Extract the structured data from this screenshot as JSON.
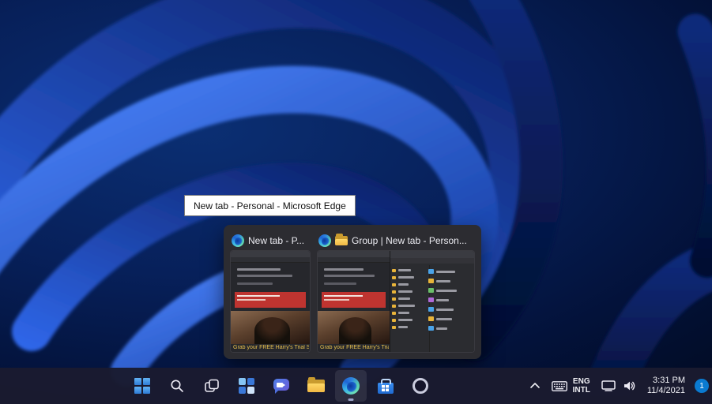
{
  "tooltip": {
    "text": "New tab - Personal - Microsoft Edge"
  },
  "preview_popup": {
    "windows": [
      {
        "title": "New tab - P...",
        "app_icon": "edge-icon",
        "caption": "Grab your FREE Harry's Trial S"
      },
      {
        "title": "Group | New tab - Person...",
        "app_icon": "edge-icon",
        "group_icon": "folder-icon",
        "caption": "Grab your FREE Harry's Trial S"
      }
    ]
  },
  "taskbar": {
    "icons": [
      "start-icon",
      "search-icon",
      "task-view-icon",
      "widgets-icon",
      "chat-icon",
      "file-explorer-icon",
      "edge-icon",
      "store-icon",
      "ring-app-icon"
    ],
    "active_app": "edge"
  },
  "system_tray": {
    "icons": [
      "chevron-up-icon",
      "keyboard-icon",
      "network-icon",
      "volume-icon"
    ],
    "language": "ENG",
    "region": "INTL",
    "time": "3:31 PM",
    "date": "11/4/2021",
    "notification_count": "1"
  },
  "colors": {
    "taskbar_bg": "#1a1b30",
    "badge_blue": "#0a7ad0",
    "banner_red": "#bf3430",
    "caption_yellow": "#e8c14d",
    "wallpaper_blue": "#2f66e8"
  }
}
